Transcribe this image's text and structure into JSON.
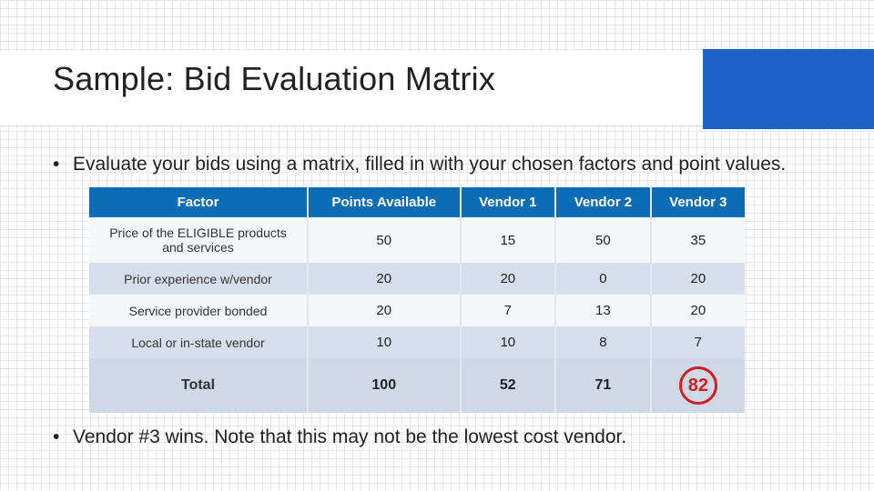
{
  "title": "Sample: Bid Evaluation Matrix",
  "bullets": {
    "intro": "Evaluate your bids using a matrix, filled in with your chosen factors and point values.",
    "conclusion": "Vendor #3 wins. Note that this may not be the lowest cost vendor."
  },
  "table": {
    "headers": [
      "Factor",
      "Points Available",
      "Vendor 1",
      "Vendor 2",
      "Vendor 3"
    ],
    "rows": [
      {
        "factor": "Price of the ELIGIBLE products and services",
        "points": "50",
        "v1": "15",
        "v2": "50",
        "v3": "35"
      },
      {
        "factor": "Prior experience w/vendor",
        "points": "20",
        "v1": "20",
        "v2": "0",
        "v3": "20"
      },
      {
        "factor": "Service provider bonded",
        "points": "20",
        "v1": "7",
        "v2": "13",
        "v3": "20"
      },
      {
        "factor": "Local or in-state vendor",
        "points": "10",
        "v1": "10",
        "v2": "8",
        "v3": "7"
      }
    ],
    "total": {
      "factor": "Total",
      "points": "100",
      "v1": "52",
      "v2": "71",
      "v3": "82"
    }
  },
  "chart_data": {
    "type": "table",
    "title": "Bid Evaluation Matrix",
    "columns": [
      "Factor",
      "Points Available",
      "Vendor 1",
      "Vendor 2",
      "Vendor 3"
    ],
    "rows": [
      [
        "Price of the ELIGIBLE products and services",
        50,
        15,
        50,
        35
      ],
      [
        "Prior experience w/vendor",
        20,
        20,
        0,
        20
      ],
      [
        "Service provider bonded",
        20,
        7,
        13,
        20
      ],
      [
        "Local or in-state vendor",
        10,
        10,
        8,
        7
      ],
      [
        "Total",
        100,
        52,
        71,
        82
      ]
    ],
    "winner": "Vendor 3",
    "winner_score": 82
  }
}
